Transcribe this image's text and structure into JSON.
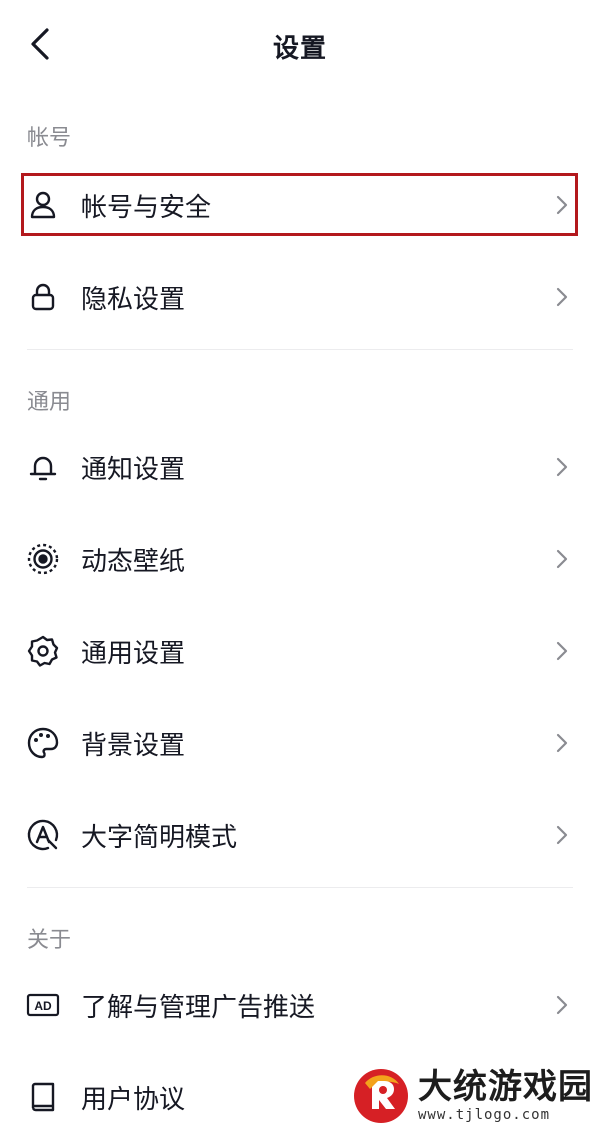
{
  "header": {
    "title": "设置",
    "back_icon": "chevron-left-icon"
  },
  "sections": [
    {
      "label": "帐号",
      "items": [
        {
          "label": "帐号与安全",
          "icon": "user-icon"
        },
        {
          "label": "隐私设置",
          "icon": "lock-icon"
        }
      ]
    },
    {
      "label": "通用",
      "items": [
        {
          "label": "通知设置",
          "icon": "bell-icon"
        },
        {
          "label": "动态壁纸",
          "icon": "wallpaper-icon"
        },
        {
          "label": "通用设置",
          "icon": "gear-icon"
        },
        {
          "label": "背景设置",
          "icon": "palette-icon"
        },
        {
          "label": "大字简明模式",
          "icon": "large-font-icon"
        }
      ]
    },
    {
      "label": "关于",
      "items": [
        {
          "label": "了解与管理广告推送",
          "icon": "ad-icon"
        },
        {
          "label": "用户协议",
          "icon": "book-icon"
        }
      ]
    }
  ],
  "watermark": {
    "name": "大统游戏园",
    "url": "www.tjlogo.com"
  },
  "colors": {
    "text": "#161823",
    "section": "#8a8b91",
    "highlight": "#b3181d"
  }
}
